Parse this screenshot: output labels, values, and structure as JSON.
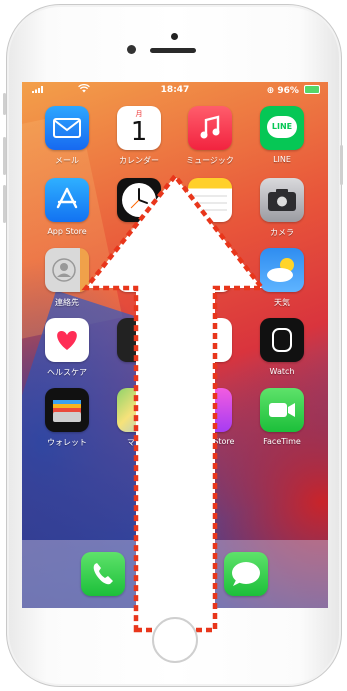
{
  "status_bar": {
    "time": "18:47",
    "battery": "96%"
  },
  "apps": [
    {
      "key": "mail",
      "label": "メール"
    },
    {
      "key": "calendar",
      "label": "カレンダー",
      "month": "月",
      "day": "1"
    },
    {
      "key": "music",
      "label": "ミュージック"
    },
    {
      "key": "line",
      "label": "LINE",
      "icon_text": "LINE"
    },
    {
      "key": "appstore",
      "label": "App Store"
    },
    {
      "key": "clock",
      "label": "時計"
    },
    {
      "key": "notes",
      "label": "メモ"
    },
    {
      "key": "camera",
      "label": "カメラ"
    },
    {
      "key": "contacts",
      "label": "連絡先"
    },
    {
      "key": "weather",
      "label": "天気"
    },
    {
      "key": "health",
      "label": "ヘルスケア"
    },
    {
      "key": "watch",
      "label": "Watch"
    },
    {
      "key": "wallet",
      "label": "ウォレット"
    },
    {
      "key": "maps",
      "label": "マップ"
    },
    {
      "key": "itunes",
      "label": "iTunes Store"
    },
    {
      "key": "facetime",
      "label": "FaceTime"
    }
  ],
  "dock": [
    "phone",
    "messages"
  ],
  "overlay": {
    "type": "swipe-up-arrow",
    "color": "#e8361b"
  }
}
